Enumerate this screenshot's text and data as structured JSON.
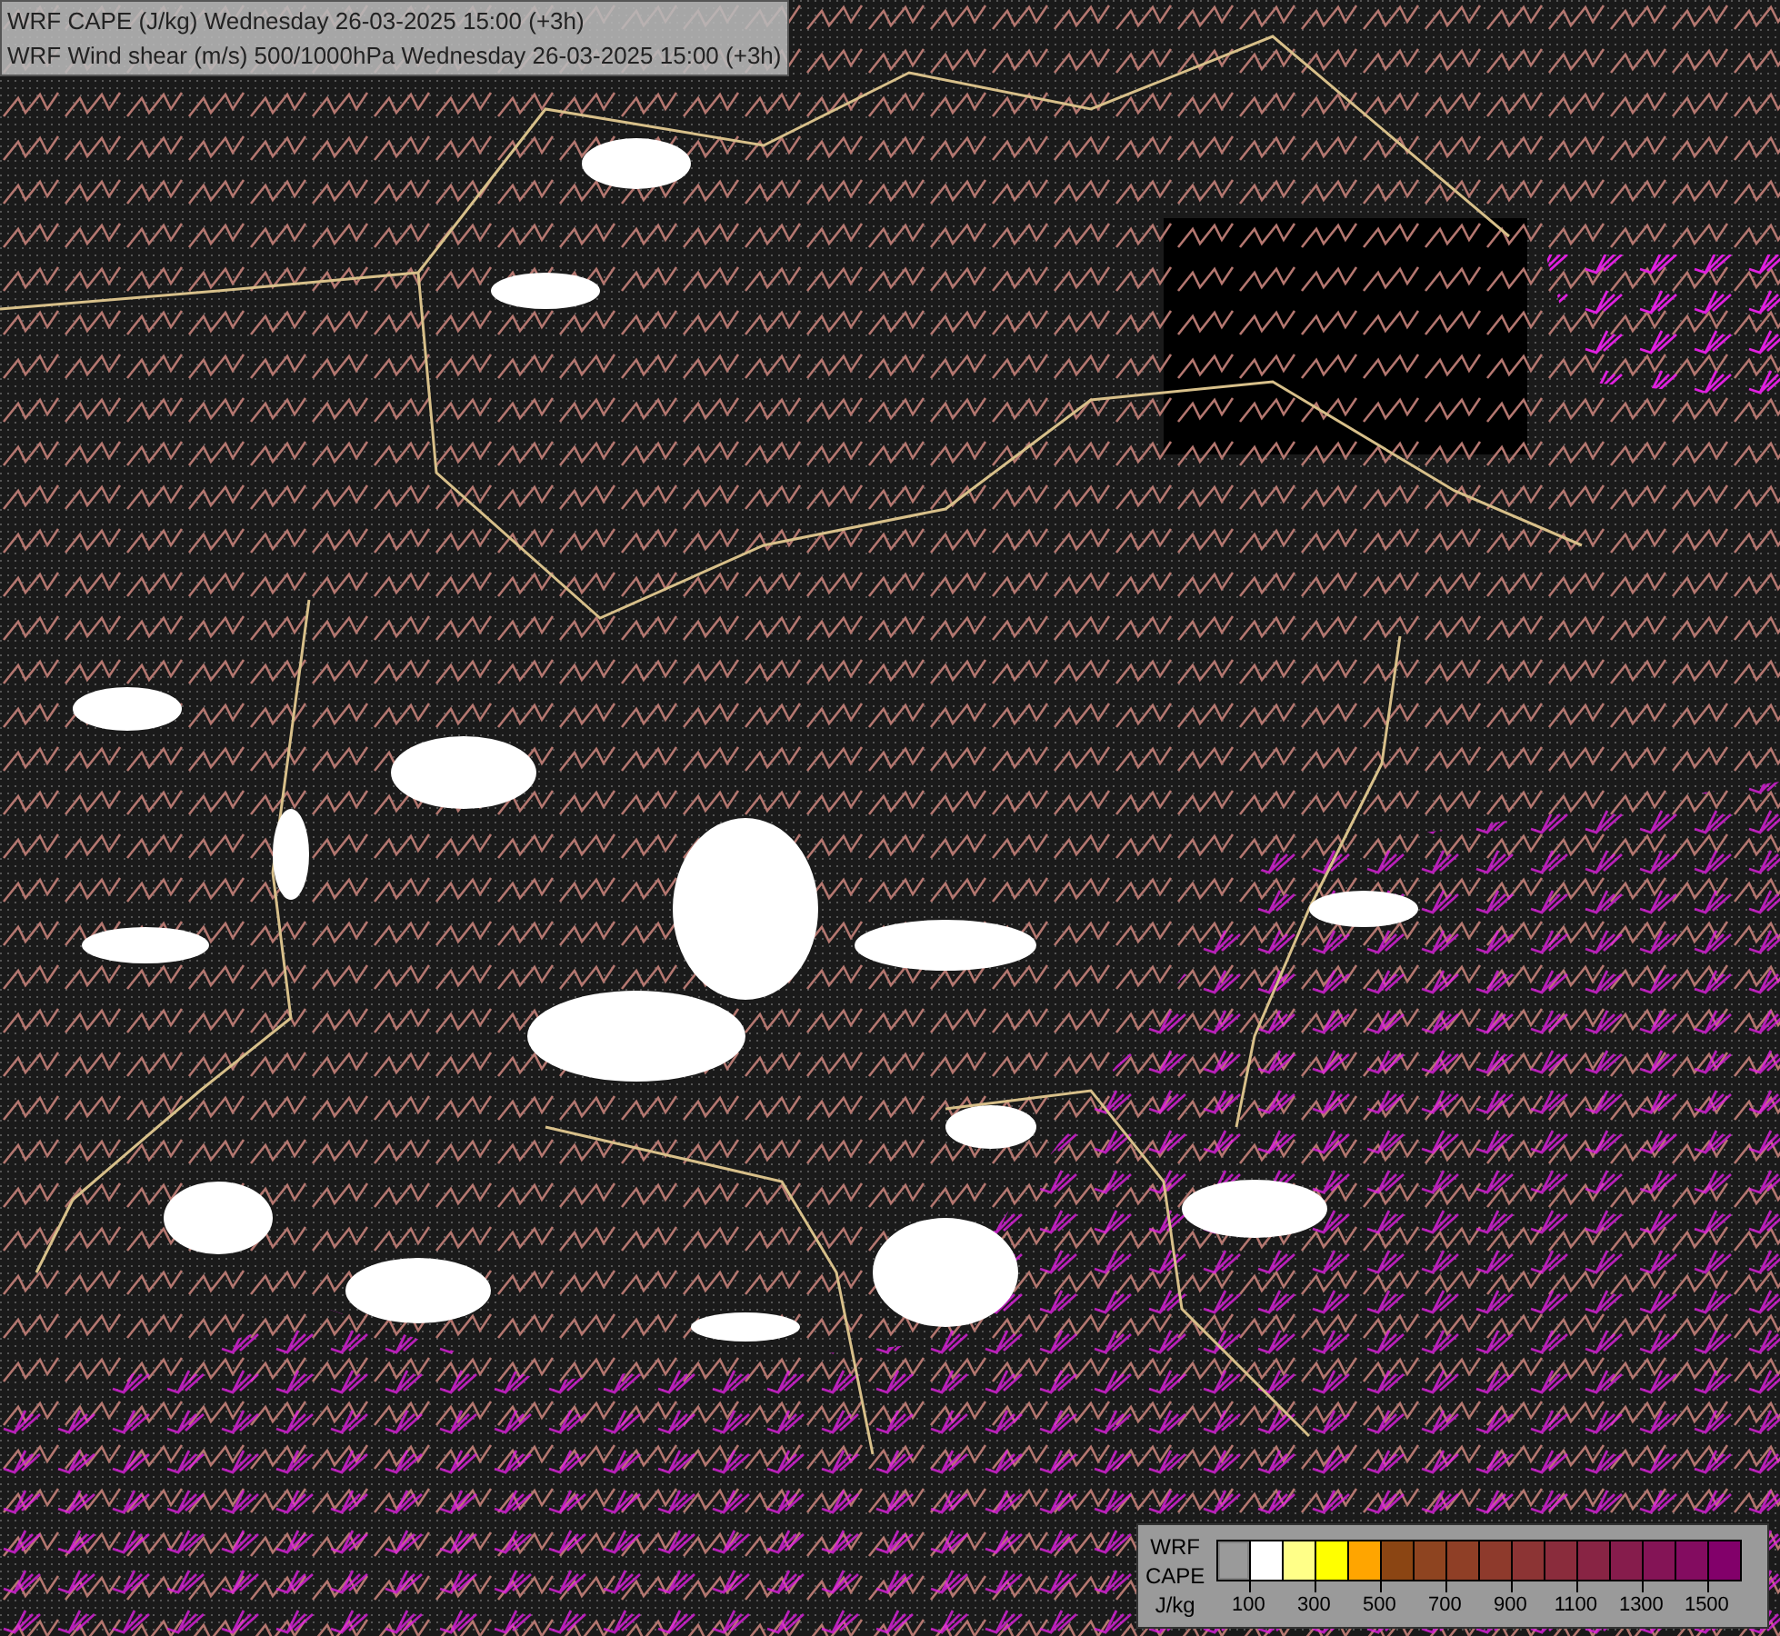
{
  "titles": [
    "WRF CAPE (J/kg) Wednesday 26-03-2025 15:00 (+3h)",
    "WRF Wind shear (m/s) 500/1000hPa Wednesday 26-03-2025 15:00 (+3h)"
  ],
  "legend": {
    "labels": [
      "WRF",
      "CAPE",
      "J/kg"
    ],
    "swatches": [
      {
        "kind": "clear",
        "color": "#9a9a9a"
      },
      {
        "kind": "fill",
        "color": "#ffffff"
      },
      {
        "kind": "fill",
        "color": "#ffff88"
      },
      {
        "kind": "fill",
        "color": "#ffff00"
      },
      {
        "kind": "fill",
        "color": "#ffa500"
      },
      {
        "kind": "fill",
        "color": "#8b4513"
      },
      {
        "kind": "fill",
        "color": "#8e4420"
      },
      {
        "kind": "fill",
        "color": "#8f3f26"
      },
      {
        "kind": "fill",
        "color": "#8e3a2c"
      },
      {
        "kind": "fill",
        "color": "#8c3434"
      },
      {
        "kind": "fill",
        "color": "#8a2c3c"
      },
      {
        "kind": "fill",
        "color": "#882444"
      },
      {
        "kind": "fill",
        "color": "#861c4c"
      },
      {
        "kind": "fill",
        "color": "#841456"
      },
      {
        "kind": "fill",
        "color": "#830c60"
      },
      {
        "kind": "fill",
        "color": "#82006a"
      }
    ],
    "ticks": [
      "100",
      "300",
      "500",
      "700",
      "900",
      "1100",
      "1300",
      "1500"
    ]
  }
}
